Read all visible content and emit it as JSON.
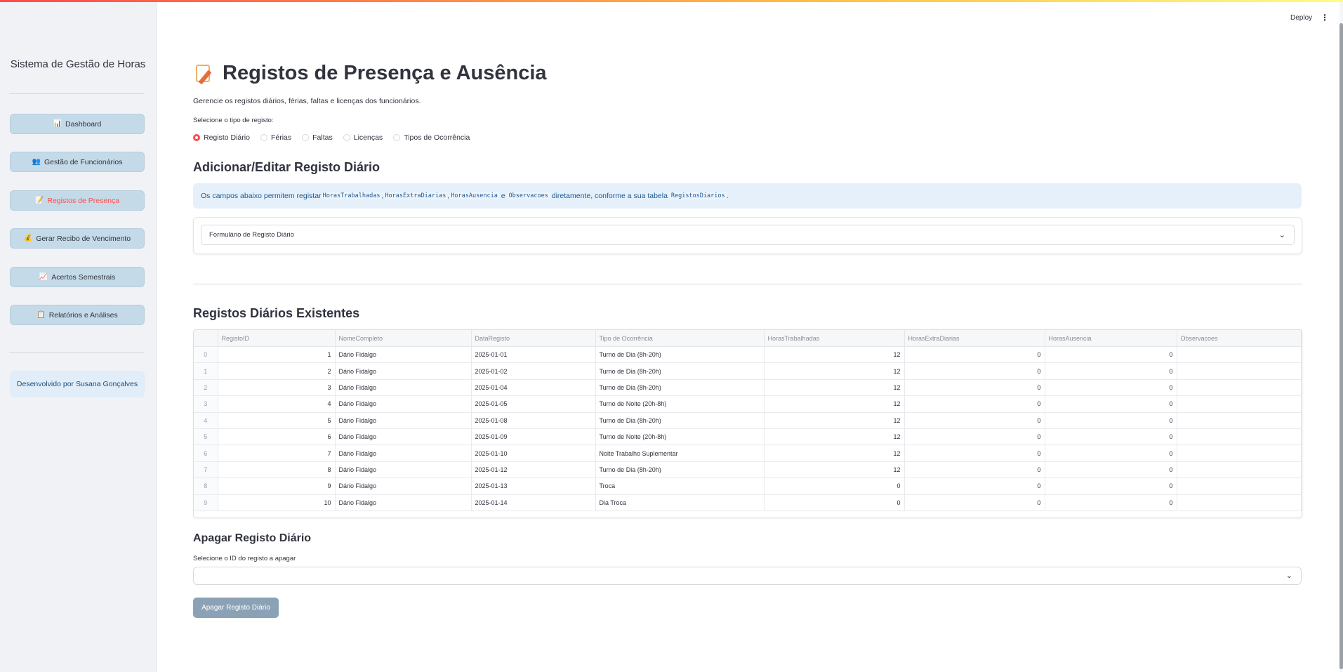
{
  "header": {
    "deploy": "Deploy",
    "menu_icon": "⋮"
  },
  "sidebar": {
    "title": "Sistema de Gestão de Horas",
    "items": [
      {
        "icon": "📊",
        "label": "Dashboard"
      },
      {
        "icon": "👥",
        "label": "Gestão de Funcionários"
      },
      {
        "icon": "📝",
        "label": "Registos de Presença",
        "active": true
      },
      {
        "icon": "💰",
        "label": "Gerar Recibo de Vencimento"
      },
      {
        "icon": "📈",
        "label": "Acertos Semestrais"
      },
      {
        "icon": "📋",
        "label": "Relatórios e Análises"
      }
    ],
    "credit": "Desenvolvido por Susana Gonçalves"
  },
  "main": {
    "title": "Registos de Presença e Ausência",
    "subtitle": "Gerencie os registos diários, férias, faltas e licenças dos funcionários.",
    "radio_label": "Selecione o tipo de registo:",
    "radios": [
      "Registo Diário",
      "Férias",
      "Faltas",
      "Licenças",
      "Tipos de Ocorrência"
    ],
    "radio_selected": "Registo Diário",
    "section_add": "Adicionar/Editar Registo Diário",
    "info": {
      "prefix": "Os campos abaixo permitem registar ",
      "c1": "HorasTrabalhadas",
      "sep1": ", ",
      "c2": "HorasExtraDiarias",
      "sep2": ", ",
      "c3": "HorasAusencia",
      "and": " e ",
      "c4": "Observacoes",
      "middle": " diretamente, conforme a sua tabela ",
      "c5": "RegistosDiarios",
      "end": "."
    },
    "expander": "Formulário de Registo Diário",
    "section_list": "Registos Diários Existentes",
    "table": {
      "columns": [
        "",
        "RegistoID",
        "NomeCompleto",
        "DataRegisto",
        "Tipo de Ocorrência",
        "HorasTrabalhadas",
        "HorasExtraDiarias",
        "HorasAusencia",
        "Observacoes"
      ],
      "rows": [
        [
          "0",
          "1",
          "Dário Fidalgo",
          "2025-01-01",
          "Turno de Dia (8h-20h)",
          "12",
          "0",
          "0",
          ""
        ],
        [
          "1",
          "2",
          "Dário Fidalgo",
          "2025-01-02",
          "Turno de Dia (8h-20h)",
          "12",
          "0",
          "0",
          ""
        ],
        [
          "2",
          "3",
          "Dário Fidalgo",
          "2025-01-04",
          "Turno de Dia (8h-20h)",
          "12",
          "0",
          "0",
          ""
        ],
        [
          "3",
          "4",
          "Dário Fidalgo",
          "2025-01-05",
          "Turno de Noite (20h-8h)",
          "12",
          "0",
          "0",
          ""
        ],
        [
          "4",
          "5",
          "Dário Fidalgo",
          "2025-01-08",
          "Turno de Dia (8h-20h)",
          "12",
          "0",
          "0",
          ""
        ],
        [
          "5",
          "6",
          "Dário Fidalgo",
          "2025-01-09",
          "Turno de Noite (20h-8h)",
          "12",
          "0",
          "0",
          ""
        ],
        [
          "6",
          "7",
          "Dário Fidalgo",
          "2025-01-10",
          "Noite Trabalho Suplementar",
          "12",
          "0",
          "0",
          ""
        ],
        [
          "7",
          "8",
          "Dário Fidalgo",
          "2025-01-12",
          "Turno de Dia (8h-20h)",
          "12",
          "0",
          "0",
          ""
        ],
        [
          "8",
          "9",
          "Dário Fidalgo",
          "2025-01-13",
          "Troca",
          "0",
          "0",
          "0",
          ""
        ],
        [
          "9",
          "10",
          "Dário Fidalgo",
          "2025-01-14",
          "Dia Troca",
          "0",
          "0",
          "0",
          ""
        ]
      ]
    },
    "section_delete": "Apagar Registo Diário",
    "select_label": "Selecione o ID do registo a apagar",
    "select_value": "",
    "delete_button": "Apagar Registo Diário"
  }
}
